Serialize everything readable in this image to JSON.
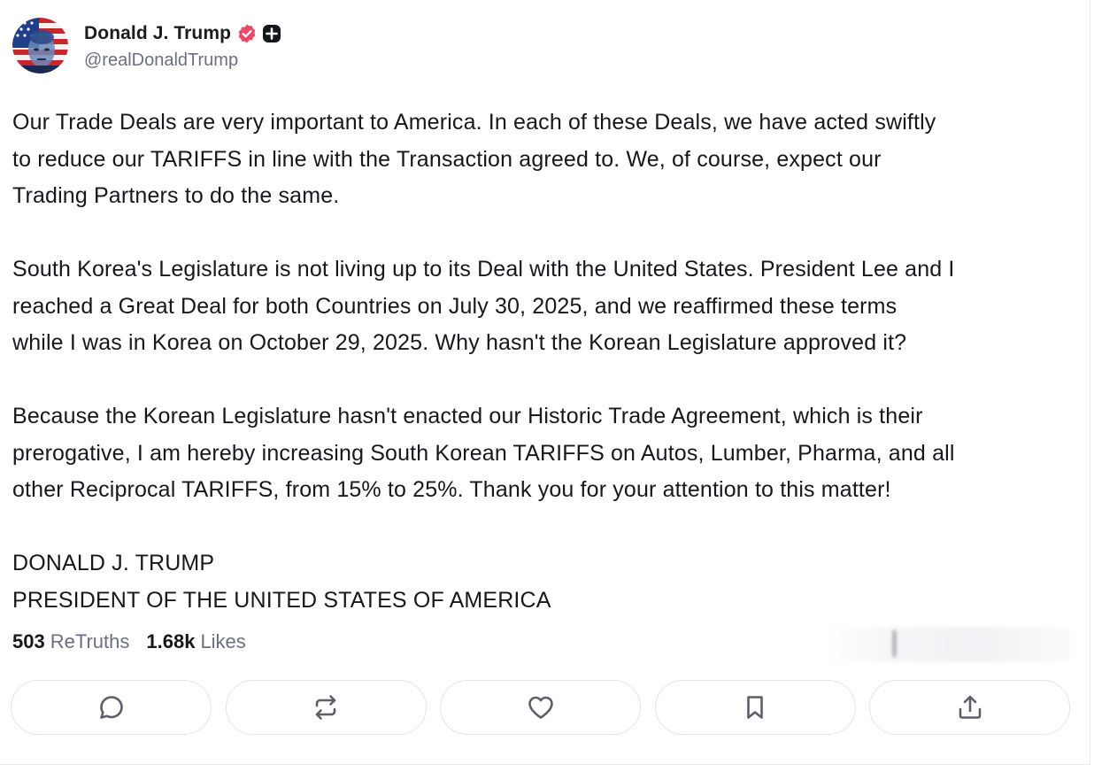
{
  "author": {
    "display_name": "Donald J. Trump",
    "handle": "@realDonaldTrump",
    "avatar_icon": "avatar-portrait-icon",
    "verified_icon": "verified-badge-icon",
    "verified_color": "#e84a6a",
    "plus_icon": "plus-badge-icon"
  },
  "post": {
    "paragraphs": [
      "Our Trade Deals are very important to America. In each of these Deals, we have acted swiftly\nto reduce our TARIFFS in line with the Transaction agreed to. We, of course, expect our\nTrading Partners to do the same.",
      "South Korea's Legislature is not living up to its Deal with the United States. President Lee and I\nreached a Great Deal for both Countries on July 30, 2025, and we reaffirmed these terms\nwhile I was in Korea on October 29, 2025. Why hasn't the Korean Legislature approved it?",
      "Because the Korean Legislature hasn't enacted our Historic Trade Agreement, which is their\nprerogative, I am hereby increasing South Korean TARIFFS on Autos, Lumber, Pharma, and all\nother Reciprocal TARIFFS, from 15% to 25%. Thank you for your attention to this matter!",
      "DONALD J. TRUMP\nPRESIDENT OF THE UNITED STATES OF AMERICA"
    ]
  },
  "stats": {
    "retruths_count": "503",
    "retruths_label": "ReTruths",
    "likes_count": "1.68k",
    "likes_label": "Likes"
  },
  "actions": [
    {
      "name": "reply-button",
      "icon": "comment-icon"
    },
    {
      "name": "retruth-button",
      "icon": "repost-icon"
    },
    {
      "name": "like-button",
      "icon": "heart-icon"
    },
    {
      "name": "bookmark-button",
      "icon": "bookmark-icon"
    },
    {
      "name": "share-button",
      "icon": "share-icon"
    }
  ],
  "colors": {
    "text": "#16181d",
    "muted": "#6b7080",
    "border": "#e3e4e8",
    "icon": "#5b5f6b"
  }
}
